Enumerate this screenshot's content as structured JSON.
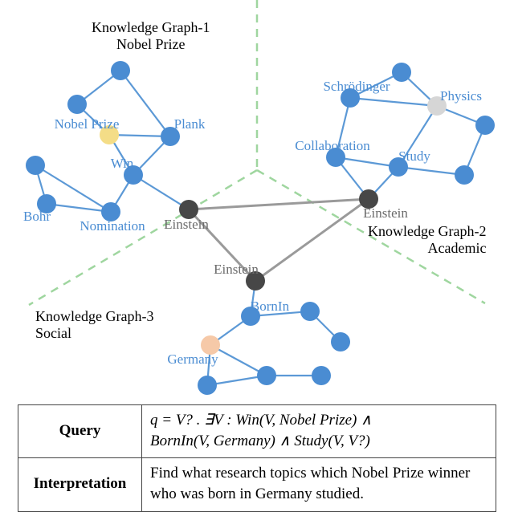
{
  "graphs": {
    "g1": {
      "title_l1": "Knowledge Graph-1",
      "title_l2": "Nobel Prize"
    },
    "g2": {
      "title_l1": "Knowledge Graph-2",
      "title_l2": "Academic"
    },
    "g3": {
      "title_l1": "Knowledge Graph-3",
      "title_l2": "Social"
    }
  },
  "nodes": {
    "nobel_prize": "Nobel Prize",
    "plank": "Plank",
    "win": "Win",
    "bohr": "Bohr",
    "nomination": "Nomination",
    "einstein_1": "Einstein",
    "schrodinger": "Schrödinger",
    "physics": "Physics",
    "collaboration": "Collaboration",
    "study": "Study",
    "einstein_2": "Einstein",
    "einstein_3": "Einstein",
    "bornin": "BornIn",
    "germany": "Germany"
  },
  "chart_data": {
    "type": "graph",
    "description": "Three knowledge graphs (Nobel Prize, Academic, Social) connected via shared entity node Einstein. Dashed green lines partition the plane into three regions.",
    "subgraphs": [
      {
        "name": "Knowledge Graph-1 Nobel Prize",
        "labeled_nodes": [
          "Nobel Prize",
          "Plank",
          "Win",
          "Bohr",
          "Nomination",
          "Einstein"
        ],
        "unlabeled_node_count": 3,
        "highlighted": {
          "Nobel Prize": "yellow"
        },
        "edges": [
          [
            "Nobel Prize",
            "Win"
          ],
          [
            "Nobel Prize",
            "Plank"
          ],
          [
            "Nobel Prize",
            "unlabeled_a"
          ],
          [
            "unlabeled_a",
            "unlabeled_b"
          ],
          [
            "unlabeled_b",
            "Plank"
          ],
          [
            "Win",
            "Nomination"
          ],
          [
            "Win",
            "Einstein"
          ],
          [
            "Win",
            "Plank"
          ],
          [
            "Bohr",
            "Nomination"
          ],
          [
            "Bohr",
            "unlabeled_c"
          ],
          [
            "unlabeled_c",
            "Nomination"
          ]
        ]
      },
      {
        "name": "Knowledge Graph-2 Academic",
        "labeled_nodes": [
          "Schrödinger",
          "Physics",
          "Collaboration",
          "Study",
          "Einstein"
        ],
        "unlabeled_node_count": 3,
        "highlighted": {
          "Physics": "light-gray"
        },
        "edges": [
          [
            "Schrödinger",
            "Physics"
          ],
          [
            "Schrödinger",
            "Collaboration"
          ],
          [
            "Schrödinger",
            "unlabeled_d"
          ],
          [
            "unlabeled_d",
            "Physics"
          ],
          [
            "Physics",
            "Study"
          ],
          [
            "Physics",
            "unlabeled_e"
          ],
          [
            "unlabeled_e",
            "unlabeled_f"
          ],
          [
            "Study",
            "unlabeled_f"
          ],
          [
            "Collaboration",
            "Study"
          ],
          [
            "Collaboration",
            "Einstein"
          ],
          [
            "Study",
            "Einstein"
          ]
        ]
      },
      {
        "name": "Knowledge Graph-3 Social",
        "labeled_nodes": [
          "Einstein",
          "BornIn",
          "Germany"
        ],
        "unlabeled_node_count": 5,
        "highlighted": {
          "Germany": "peach"
        },
        "edges": [
          [
            "Einstein",
            "BornIn"
          ],
          [
            "BornIn",
            "Germany"
          ],
          [
            "BornIn",
            "unlabeled_g"
          ],
          [
            "unlabeled_g",
            "unlabeled_h"
          ],
          [
            "Germany",
            "unlabeled_i"
          ],
          [
            "Germany",
            "unlabeled_j"
          ],
          [
            "unlabeled_i",
            "unlabeled_j"
          ],
          [
            "unlabeled_j",
            "unlabeled_k"
          ]
        ]
      }
    ],
    "bridge_edges": [
      [
        "Einstein(G1)",
        "Einstein(G2)"
      ],
      [
        "Einstein(G1)",
        "Einstein(G3)"
      ],
      [
        "Einstein(G2)",
        "Einstein(G3)"
      ]
    ]
  },
  "table": {
    "query_key": "Query",
    "query_val_line1": "q = V? . ∃V : Win(V, Nobel Prize) ∧",
    "query_val_line2": "BornIn(V, Germany) ∧ Study(V, V?)",
    "interp_key": "Interpretation",
    "interp_val": "Find what research topics which Nobel Prize winner who was born in Germany studied."
  }
}
